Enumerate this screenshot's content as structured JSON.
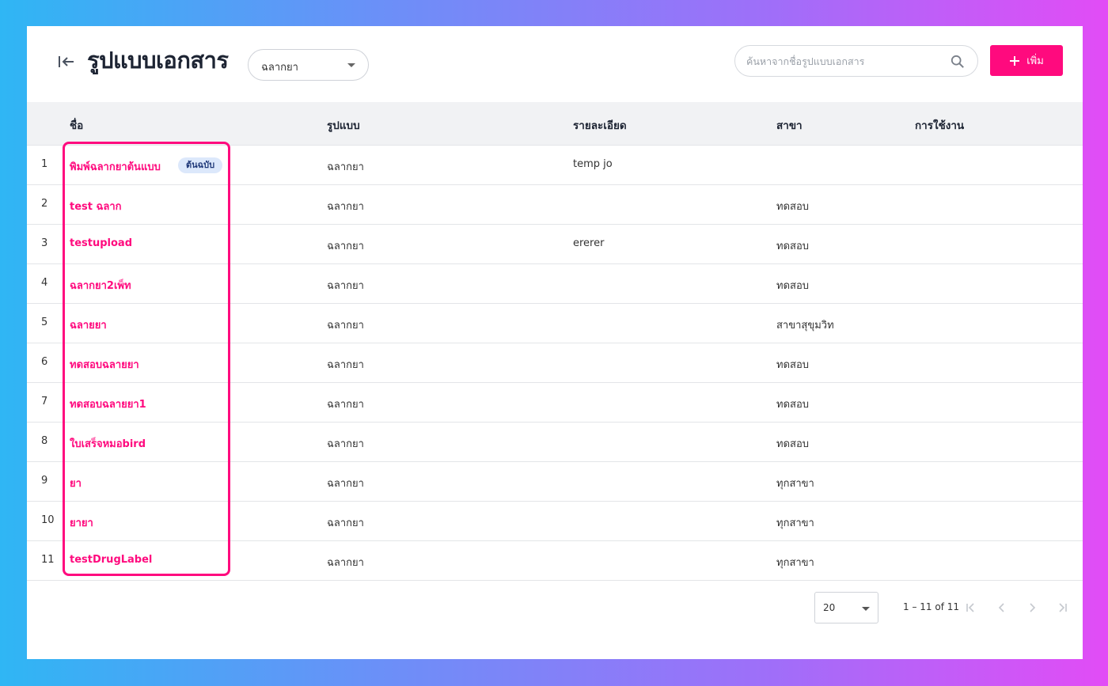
{
  "header": {
    "title": "รูปแบบเอกสาร",
    "type_filter": "ฉลากยา",
    "search_placeholder": "ค้นหาจากชื่อรูปแบบเอกสาร",
    "add_label": "เพิ่ม"
  },
  "table": {
    "columns": {
      "name": "ชื่อ",
      "format": "รูปแบบ",
      "detail": "รายละเอียด",
      "branch": "สาขา",
      "usage": "การใช้งาน"
    },
    "rows": [
      {
        "num": "1",
        "name": "พิมพ์ฉลากยาต้นแบบ",
        "badge": "ต้นฉบับ",
        "format": "ฉลากยา",
        "detail": "temp jo",
        "branch": ""
      },
      {
        "num": "2",
        "name": "test ฉลาก",
        "format": "ฉลากยา",
        "detail": "",
        "branch": "ทดสอบ"
      },
      {
        "num": "3",
        "name": "testupload",
        "format": "ฉลากยา",
        "detail": "ererer",
        "branch": "ทดสอบ"
      },
      {
        "num": "4",
        "name": "ฉลากยา2เพ็ท",
        "format": "ฉลากยา",
        "detail": "",
        "branch": "ทดสอบ"
      },
      {
        "num": "5",
        "name": "ฉลายยา",
        "format": "ฉลากยา",
        "detail": "",
        "branch": "สาขาสุขุมวิท"
      },
      {
        "num": "6",
        "name": "ทดสอบฉลายยา",
        "format": "ฉลากยา",
        "detail": "",
        "branch": "ทดสอบ"
      },
      {
        "num": "7",
        "name": "ทดสอบฉลายยา1",
        "format": "ฉลากยา",
        "detail": "",
        "branch": "ทดสอบ"
      },
      {
        "num": "8",
        "name": "ใบเสร็จหมอbird",
        "format": "ฉลากยา",
        "detail": "",
        "branch": "ทดสอบ"
      },
      {
        "num": "9",
        "name": "ยา",
        "format": "ฉลากยา",
        "detail": "",
        "branch": "ทุกสาขา"
      },
      {
        "num": "10",
        "name": "ยายา",
        "format": "ฉลากยา",
        "detail": "",
        "branch": "ทุกสาขา"
      },
      {
        "num": "11",
        "name": "testDrugLabel",
        "format": "ฉลากยา",
        "detail": "",
        "branch": "ทุกสาขา"
      }
    ]
  },
  "pagination": {
    "page_size": "20",
    "range": "1 – 11 of 11"
  },
  "colors": {
    "accent": "#ff0a7e",
    "badge_bg": "#dce8fb",
    "header_bg": "#f1f2f4"
  }
}
